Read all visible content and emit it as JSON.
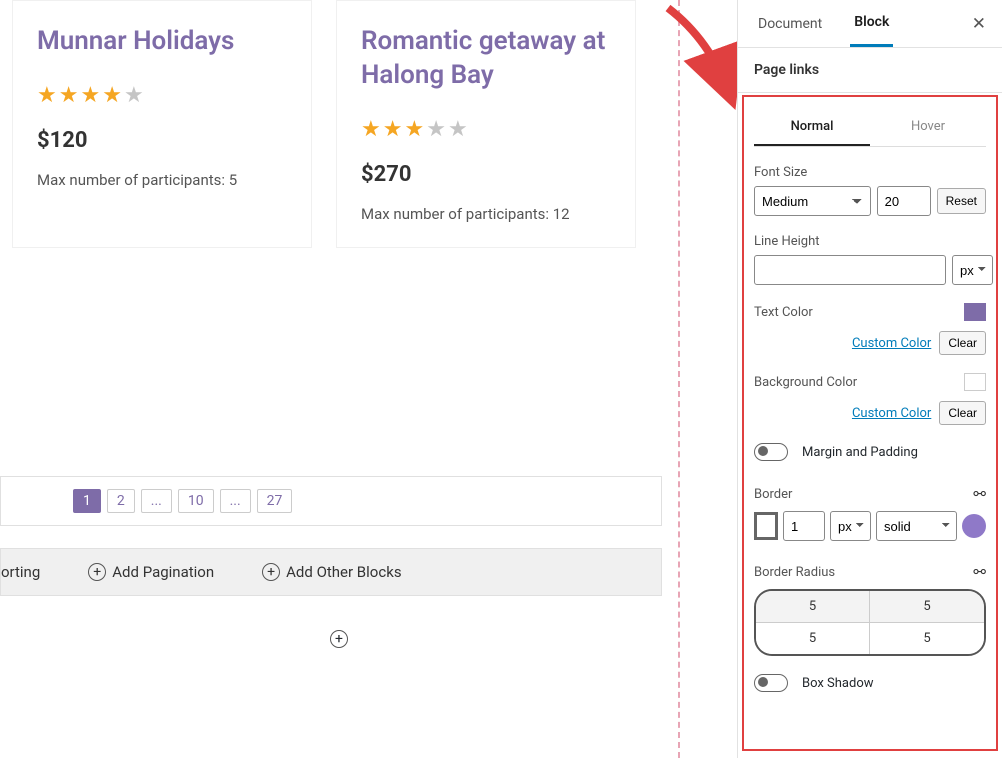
{
  "cards": [
    {
      "title": "Munnar Holidays",
      "rating": 4,
      "price": "$120",
      "participants": "Max number of participants: 5"
    },
    {
      "title": "Romantic getaway at Halong Bay",
      "rating": 3,
      "price": "$270",
      "participants": "Max number of participants: 12"
    }
  ],
  "pagination": [
    "1",
    "2",
    "...",
    "10",
    "...",
    "27"
  ],
  "toolbar": {
    "sorting": "orting",
    "add_pagination": "Add Pagination",
    "add_other": "Add Other Blocks"
  },
  "sidebar": {
    "tabs": {
      "document": "Document",
      "block": "Block"
    },
    "panel_title": "Page links",
    "style_tabs": {
      "normal": "Normal",
      "hover": "Hover"
    },
    "font_size_label": "Font Size",
    "font_size_select": "Medium",
    "font_size_value": "20",
    "reset": "Reset",
    "line_height_label": "Line Height",
    "line_height_unit": "px",
    "text_color_label": "Text Color",
    "custom_color": "Custom Color",
    "clear": "Clear",
    "bg_color_label": "Background Color",
    "margin_padding": "Margin and Padding",
    "border_label": "Border",
    "border_width": "1",
    "border_unit": "px",
    "border_style": "solid",
    "border_radius_label": "Border Radius",
    "radius_values": [
      "5",
      "5",
      "5",
      "5"
    ],
    "box_shadow": "Box Shadow"
  }
}
